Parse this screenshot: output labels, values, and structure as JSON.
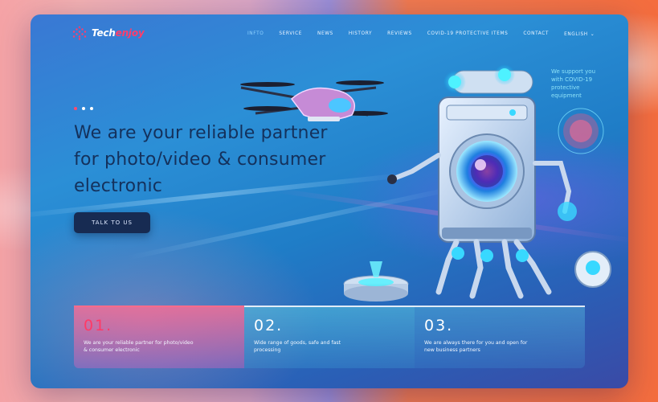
{
  "brand": {
    "name_part1": "Tech",
    "name_part2": "enjoy",
    "accent_color": "#ff3d6b"
  },
  "nav": {
    "items": [
      {
        "label": "INFTO",
        "active": true
      },
      {
        "label": "SERVICE",
        "active": false
      },
      {
        "label": "NEWS",
        "active": false
      },
      {
        "label": "HISTORY",
        "active": false
      },
      {
        "label": "REVIEWS",
        "active": false
      },
      {
        "label": "COVID-19 PROTECTIVE ITEMS",
        "active": false
      },
      {
        "label": "CONTACT",
        "active": false
      }
    ],
    "language": "ENGLISH",
    "language_caret_icon": "chevron-down-icon"
  },
  "hero": {
    "headline_line1": "We are your reliable partner",
    "headline_line2": "for photo/video & consumer",
    "headline_line3": "electronic",
    "cta_label": "TALK TO US",
    "slider_dots": 3,
    "active_dot": 1
  },
  "illustration": {
    "hologram_text": "We support you with COVID-19 protective equipment"
  },
  "features": [
    {
      "number": "01.",
      "text": "We are your reliable partner for photo/video & consumer electronic"
    },
    {
      "number": "02.",
      "text": "Wide range of goods, safe and fast processing"
    },
    {
      "number": "03.",
      "text": "We are always there for you and open for new business partners"
    }
  ],
  "colors": {
    "headline": "#14315c",
    "cta_bg": "#172b52",
    "feature_highlight": "#ff3a66"
  }
}
